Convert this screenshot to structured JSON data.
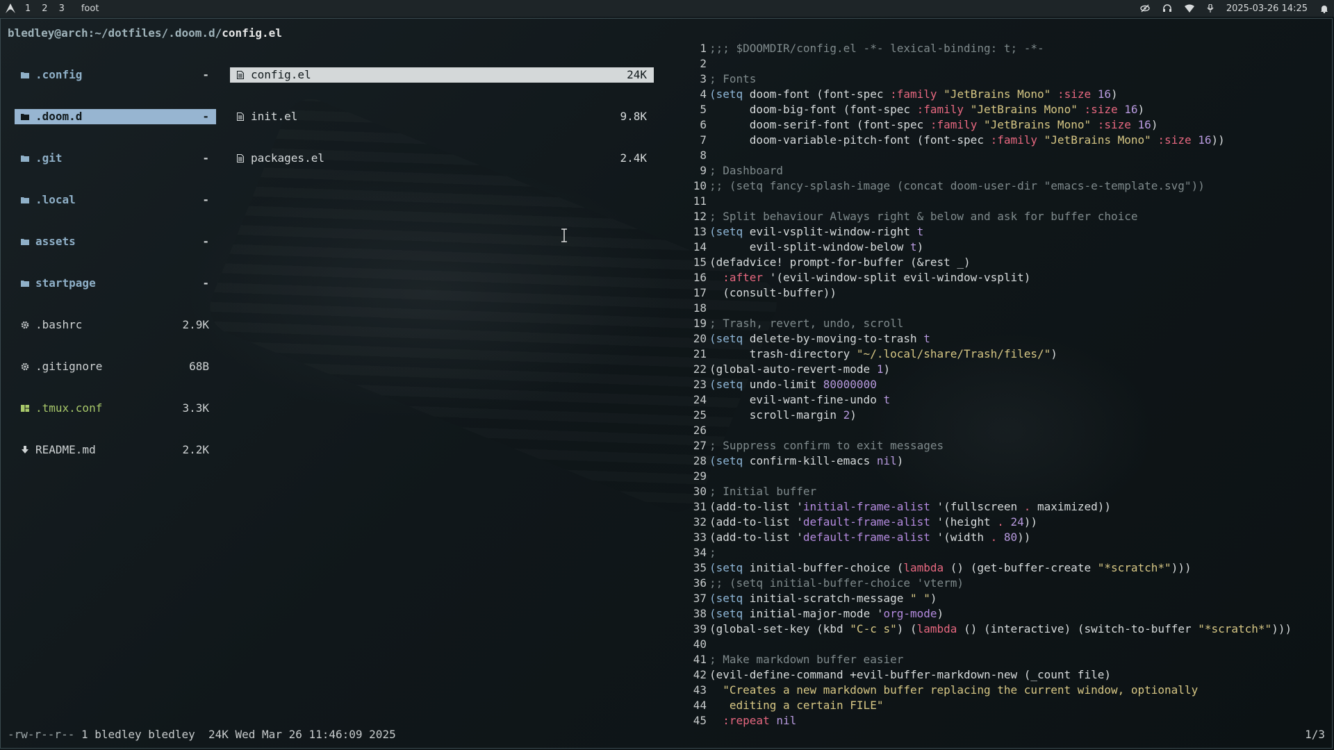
{
  "topbar": {
    "workspaces": [
      "1",
      "2",
      "3"
    ],
    "app_title": "foot",
    "datetime": "2025-03-26 14:25"
  },
  "terminal": {
    "prompt": "bledley@arch:~/dotfiles/.doom.d/",
    "current_file": "config.el",
    "parent_list": [
      {
        "name": ".config",
        "size": "-",
        "type": "dir"
      },
      {
        "name": ".doom.d",
        "size": "-",
        "type": "dir",
        "selected": true
      },
      {
        "name": ".git",
        "size": "-",
        "type": "dir"
      },
      {
        "name": ".local",
        "size": "-",
        "type": "dir"
      },
      {
        "name": "assets",
        "size": "-",
        "type": "dir"
      },
      {
        "name": "startpage",
        "size": "-",
        "type": "dir"
      },
      {
        "name": ".bashrc",
        "size": "2.9K",
        "type": "gear"
      },
      {
        "name": ".gitignore",
        "size": "68B",
        "type": "gear"
      },
      {
        "name": ".tmux.conf",
        "size": "3.3K",
        "type": "tmux"
      },
      {
        "name": "README.md",
        "size": "2.2K",
        "type": "md"
      }
    ],
    "current_list": [
      {
        "name": "config.el",
        "size": "24K",
        "selected": true
      },
      {
        "name": "init.el",
        "size": "9.8K"
      },
      {
        "name": "packages.el",
        "size": "2.4K"
      }
    ],
    "status": {
      "permissions": "-rw-r--r--",
      "info": " 1 bledley bledley  24K Wed Mar 26 11:46:09 2025",
      "position": "1/3"
    }
  },
  "preview_lines": [
    [
      [
        "c-com",
        ";;; $DOOMDIR/config.el -*- lexical-binding: t; -*-"
      ]
    ],
    [],
    [
      [
        "c-com",
        "; Fonts"
      ]
    ],
    [
      [
        "c-kw",
        "(setq"
      ],
      [
        "",
        " doom-font (font-spec "
      ],
      [
        "c-key",
        ":family"
      ],
      [
        "",
        " "
      ],
      [
        "c-str",
        "\"JetBrains Mono\""
      ],
      [
        "",
        " "
      ],
      [
        "c-key",
        ":size"
      ],
      [
        "",
        " "
      ],
      [
        "c-num",
        "16"
      ],
      [
        "",
        ")"
      ]
    ],
    [
      [
        "",
        "      doom-big-font (font-spec "
      ],
      [
        "c-key",
        ":family"
      ],
      [
        "",
        " "
      ],
      [
        "c-str",
        "\"JetBrains Mono\""
      ],
      [
        "",
        " "
      ],
      [
        "c-key",
        ":size"
      ],
      [
        "",
        " "
      ],
      [
        "c-num",
        "16"
      ],
      [
        "",
        ")"
      ]
    ],
    [
      [
        "",
        "      doom-serif-font (font-spec "
      ],
      [
        "c-key",
        ":family"
      ],
      [
        "",
        " "
      ],
      [
        "c-str",
        "\"JetBrains Mono\""
      ],
      [
        "",
        " "
      ],
      [
        "c-key",
        ":size"
      ],
      [
        "",
        " "
      ],
      [
        "c-num",
        "16"
      ],
      [
        "",
        ")"
      ]
    ],
    [
      [
        "",
        "      doom-variable-pitch-font (font-spec "
      ],
      [
        "c-key",
        ":family"
      ],
      [
        "",
        " "
      ],
      [
        "c-str",
        "\"JetBrains Mono\""
      ],
      [
        "",
        " "
      ],
      [
        "c-key",
        ":size"
      ],
      [
        "",
        " "
      ],
      [
        "c-num",
        "16"
      ],
      [
        "",
        "))"
      ]
    ],
    [],
    [
      [
        "c-com",
        "; Dashboard"
      ]
    ],
    [
      [
        "c-com",
        ";; (setq fancy-splash-image (concat doom-user-dir \"emacs-e-template.svg\"))"
      ]
    ],
    [],
    [
      [
        "c-com",
        "; Split behaviour Always right & below and ask for buffer choice"
      ]
    ],
    [
      [
        "c-kw",
        "(setq"
      ],
      [
        "",
        " evil-vsplit-window-right "
      ],
      [
        "c-t",
        "t"
      ]
    ],
    [
      [
        "",
        "      evil-split-window-below "
      ],
      [
        "c-t",
        "t"
      ],
      [
        "",
        ")"
      ]
    ],
    [
      [
        "",
        "(defadvice! prompt-for-buffer (&rest _)"
      ]
    ],
    [
      [
        "",
        "  "
      ],
      [
        "c-key",
        ":after"
      ],
      [
        "",
        " '(evil-window-split evil-window-vsplit)"
      ]
    ],
    [
      [
        "",
        "  (consult-buffer))"
      ]
    ],
    [],
    [
      [
        "c-com",
        "; Trash, revert, undo, scroll"
      ]
    ],
    [
      [
        "c-kw",
        "(setq"
      ],
      [
        "",
        " delete-by-moving-to-trash "
      ],
      [
        "c-t",
        "t"
      ]
    ],
    [
      [
        "",
        "      trash-directory "
      ],
      [
        "c-str",
        "\"~/.local/share/Trash/files/\""
      ],
      [
        "",
        ")"
      ]
    ],
    [
      [
        "",
        "(global-auto-revert-mode "
      ],
      [
        "c-num",
        "1"
      ],
      [
        "",
        ")"
      ]
    ],
    [
      [
        "c-kw",
        "(setq"
      ],
      [
        "",
        " undo-limit "
      ],
      [
        "c-num",
        "80000000"
      ]
    ],
    [
      [
        "",
        "      evil-want-fine-undo "
      ],
      [
        "c-t",
        "t"
      ]
    ],
    [
      [
        "",
        "      scroll-margin "
      ],
      [
        "c-num",
        "2"
      ],
      [
        "",
        ")"
      ]
    ],
    [],
    [
      [
        "c-com",
        "; Suppress confirm to exit messages"
      ]
    ],
    [
      [
        "c-kw",
        "(setq"
      ],
      [
        "",
        " confirm-kill-emacs "
      ],
      [
        "c-t",
        "nil"
      ],
      [
        "",
        ")"
      ]
    ],
    [],
    [
      [
        "c-com",
        "; Initial buffer"
      ]
    ],
    [
      [
        "",
        "(add-to-list '"
      ],
      [
        "c-var",
        "initial-frame-alist"
      ],
      [
        "",
        " '(fullscreen "
      ],
      [
        "c-key",
        "."
      ],
      [
        "",
        " maximized))"
      ]
    ],
    [
      [
        "",
        "(add-to-list '"
      ],
      [
        "c-var",
        "default-frame-alist"
      ],
      [
        "",
        " '(height "
      ],
      [
        "c-key",
        "."
      ],
      [
        "",
        " "
      ],
      [
        "c-num",
        "24"
      ],
      [
        "",
        "))"
      ]
    ],
    [
      [
        "",
        "(add-to-list '"
      ],
      [
        "c-var",
        "default-frame-alist"
      ],
      [
        "",
        " '(width "
      ],
      [
        "c-key",
        "."
      ],
      [
        "",
        " "
      ],
      [
        "c-num",
        "80"
      ],
      [
        "",
        "))"
      ]
    ],
    [
      [
        "c-com",
        ";"
      ]
    ],
    [
      [
        "c-kw",
        "(setq"
      ],
      [
        "",
        " initial-buffer-choice ("
      ],
      [
        "c-key",
        "lambda"
      ],
      [
        "",
        " () (get-buffer-create "
      ],
      [
        "c-str",
        "\"*scratch*\""
      ],
      [
        "",
        ")))"
      ]
    ],
    [
      [
        "c-com",
        ";; (setq initial-buffer-choice 'vterm)"
      ]
    ],
    [
      [
        "c-kw",
        "(setq"
      ],
      [
        "",
        " initial-scratch-message "
      ],
      [
        "c-str",
        "\" \""
      ],
      [
        "",
        ")"
      ]
    ],
    [
      [
        "c-kw",
        "(setq"
      ],
      [
        "",
        " initial-major-mode '"
      ],
      [
        "c-var",
        "org-mode"
      ],
      [
        "",
        ")"
      ]
    ],
    [
      [
        "",
        "(global-set-key (kbd "
      ],
      [
        "c-str",
        "\"C-c s\""
      ],
      [
        "",
        ") ("
      ],
      [
        "c-key",
        "lambda"
      ],
      [
        "",
        " () (interactive) (switch-to-buffer "
      ],
      [
        "c-str",
        "\"*scratch*\""
      ],
      [
        "",
        ")))"
      ]
    ],
    [],
    [
      [
        "c-com",
        "; Make markdown buffer easier"
      ]
    ],
    [
      [
        "",
        "(evil-define-command +evil-buffer-markdown-new (_count file)"
      ]
    ],
    [
      [
        "",
        "  "
      ],
      [
        "c-str",
        "\"Creates a new markdown buffer replacing the current window, optionally"
      ]
    ],
    [
      [
        "c-str",
        "   editing a certain FILE\""
      ]
    ],
    [
      [
        "",
        "  "
      ],
      [
        "c-key",
        ":repeat"
      ],
      [
        "",
        " "
      ],
      [
        "c-t",
        "nil"
      ]
    ]
  ]
}
